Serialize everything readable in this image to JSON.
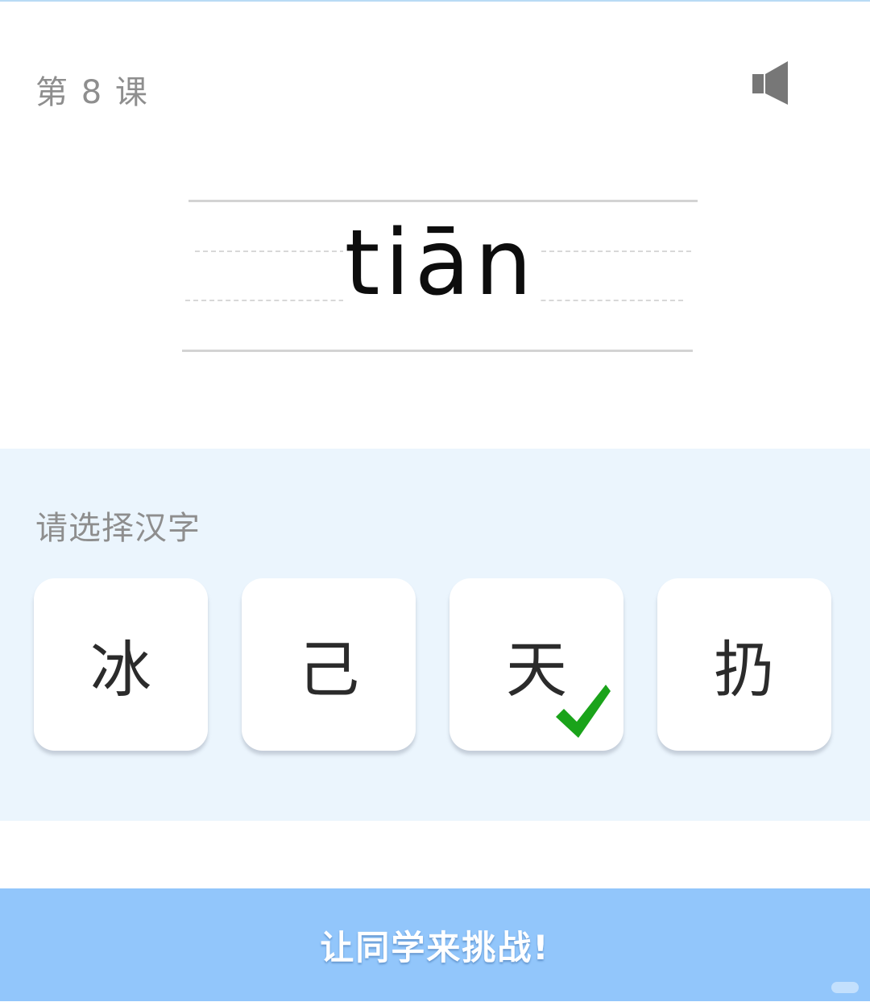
{
  "header": {
    "lesson_title": "第 8 课",
    "speaker_icon": "speaker-icon"
  },
  "pinyin": {
    "text": "tiān"
  },
  "answer": {
    "prompt": "请选择汉字",
    "choices": [
      {
        "char": "冰",
        "correct": false
      },
      {
        "char": "己",
        "correct": false
      },
      {
        "char": "天",
        "correct": true
      },
      {
        "char": "扔",
        "correct": false
      }
    ],
    "correct_icon": "checkmark-icon",
    "correct_color": "#1aa31a"
  },
  "footer": {
    "challenge_label": "让同学来挑战!"
  },
  "colors": {
    "answer_bg": "#ebf5fd",
    "button_bg": "#92c6fb",
    "muted_text": "#8e8e8e"
  }
}
